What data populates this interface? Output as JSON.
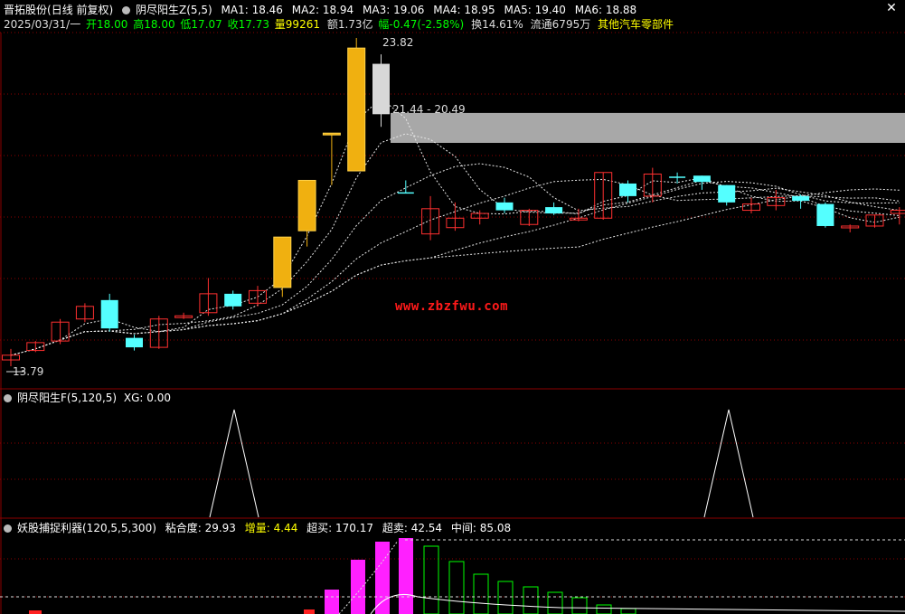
{
  "header": {
    "stock_name": "晋拓股份",
    "period": "(日线 前复权)",
    "indicator": "阴尽阳生Z(5,5)",
    "ma": [
      {
        "label": "MA1: 18.46",
        "color": "#ffffff"
      },
      {
        "label": "MA2: 18.94",
        "color": "#ffffff"
      },
      {
        "label": "MA3: 19.06",
        "color": "#ffffff"
      },
      {
        "label": "MA4: 18.95",
        "color": "#ffffff"
      },
      {
        "label": "MA5: 19.40",
        "color": "#ffffff"
      },
      {
        "label": "MA6: 18.88",
        "color": "#ffffff"
      }
    ],
    "close_symbol": "✕"
  },
  "quote": {
    "date": "2025/03/31/一",
    "open": "开18.00",
    "high": "高18.00",
    "low": "低17.07",
    "close": "收17.73",
    "volume": "量99261",
    "amount": "额1.73亿",
    "change": "幅-0.47(-2.58%)",
    "turnover": "换14.61%",
    "float": "流通6795万",
    "sector": "其他汽车零部件"
  },
  "main_chart": {
    "price_max_label": "23.82",
    "price_min_label": "13.79",
    "range_label": "21.44 - 20.49",
    "watermark": "www.zbzfwu.com",
    "candles": [
      {
        "o": 13.6,
        "c": 13.75,
        "h": 13.95,
        "l": 13.4,
        "up": true
      },
      {
        "o": 13.9,
        "c": 14.15,
        "h": 14.2,
        "l": 13.85,
        "up": true
      },
      {
        "o": 14.2,
        "c": 14.8,
        "h": 14.9,
        "l": 14.1,
        "up": true
      },
      {
        "o": 14.9,
        "c": 15.3,
        "h": 15.4,
        "l": 14.8,
        "up": true
      },
      {
        "o": 15.5,
        "c": 14.6,
        "h": 15.7,
        "l": 14.5,
        "up": false
      },
      {
        "o": 14.3,
        "c": 14.0,
        "h": 14.4,
        "l": 13.9,
        "up": false
      },
      {
        "o": 14.0,
        "c": 14.9,
        "h": 15.0,
        "l": 13.95,
        "up": true
      },
      {
        "o": 14.95,
        "c": 15.0,
        "h": 15.1,
        "l": 14.9,
        "up": true
      },
      {
        "o": 15.1,
        "c": 15.7,
        "h": 16.2,
        "l": 15.0,
        "up": true
      },
      {
        "o": 15.7,
        "c": 15.3,
        "h": 15.8,
        "l": 15.2,
        "up": false
      },
      {
        "o": 15.4,
        "c": 15.8,
        "h": 15.95,
        "l": 15.3,
        "up": true
      },
      {
        "o": 15.9,
        "c": 17.5,
        "h": 17.5,
        "l": 15.6,
        "up": true,
        "gold": true
      },
      {
        "o": 17.7,
        "c": 19.3,
        "h": 19.3,
        "l": 17.2,
        "up": true,
        "gold": true
      },
      {
        "o": 20.8,
        "c": 20.8,
        "h": 20.8,
        "l": 19.15,
        "up": true,
        "gold": true
      },
      {
        "o": 19.6,
        "c": 23.5,
        "h": 23.82,
        "l": 19.6,
        "up": true,
        "gold": true
      },
      {
        "o": 23.0,
        "c": 21.4,
        "h": 23.3,
        "l": 21.0,
        "up": false,
        "white": true
      },
      {
        "o": 18.9,
        "c": 18.9,
        "h": 19.3,
        "l": 18.9,
        "up": false,
        "cross": true
      },
      {
        "o": 17.6,
        "c": 18.4,
        "h": 18.8,
        "l": 17.4,
        "up": true
      },
      {
        "o": 17.8,
        "c": 18.1,
        "h": 18.6,
        "l": 17.7,
        "up": true
      },
      {
        "o": 18.1,
        "c": 18.25,
        "h": 18.35,
        "l": 17.9,
        "up": true
      },
      {
        "o": 18.6,
        "c": 18.35,
        "h": 18.75,
        "l": 18.25,
        "up": false
      },
      {
        "o": 17.9,
        "c": 18.35,
        "h": 18.4,
        "l": 17.85,
        "up": true
      },
      {
        "o": 18.45,
        "c": 18.25,
        "h": 18.6,
        "l": 18.2,
        "up": false
      },
      {
        "o": 18.05,
        "c": 18.1,
        "h": 18.4,
        "l": 18.0,
        "up": true
      },
      {
        "o": 18.1,
        "c": 19.55,
        "h": 19.55,
        "l": 18.05,
        "up": true
      },
      {
        "o": 19.2,
        "c": 18.8,
        "h": 19.3,
        "l": 18.6,
        "up": false
      },
      {
        "o": 18.8,
        "c": 19.5,
        "h": 19.7,
        "l": 18.6,
        "up": true
      },
      {
        "o": 19.4,
        "c": 19.4,
        "h": 19.55,
        "l": 19.2,
        "up": false,
        "cross": true
      },
      {
        "o": 19.45,
        "c": 19.25,
        "h": 19.45,
        "l": 19.0,
        "up": false
      },
      {
        "o": 19.15,
        "c": 18.6,
        "h": 19.15,
        "l": 18.5,
        "up": false
      },
      {
        "o": 18.35,
        "c": 18.55,
        "h": 18.75,
        "l": 18.25,
        "up": true
      },
      {
        "o": 18.5,
        "c": 18.75,
        "h": 19.0,
        "l": 18.35,
        "up": true
      },
      {
        "o": 18.8,
        "c": 18.65,
        "h": 18.85,
        "l": 18.4,
        "up": false
      },
      {
        "o": 18.55,
        "c": 17.85,
        "h": 18.6,
        "l": 17.8,
        "up": false
      },
      {
        "o": 17.8,
        "c": 17.85,
        "h": 17.9,
        "l": 17.65,
        "up": true
      },
      {
        "o": 17.85,
        "c": 18.2,
        "h": 18.2,
        "l": 17.8,
        "up": true
      },
      {
        "o": 18.25,
        "c": 18.35,
        "h": 18.45,
        "l": 17.9,
        "up": true
      }
    ]
  },
  "panel2": {
    "title": "阴尽阳生F(5,120,5)",
    "xg_label": "XG: 0.00"
  },
  "panel3": {
    "title": "妖股捕捉利器(120,5,5,300)",
    "stats": [
      {
        "label": "粘合度: 29.93",
        "color": "#ffffff"
      },
      {
        "label": "增量: 4.44",
        "color": "#ffff00"
      },
      {
        "label": "超买: 170.17",
        "color": "#ffffff"
      },
      {
        "label": "超卖: 42.54",
        "color": "#ffffff"
      },
      {
        "label": "中间: 85.08",
        "color": "#ffffff"
      }
    ]
  },
  "colors": {
    "up": "#ff3030",
    "down": "#54ffff",
    "gold": "#f0b010",
    "grid": "#8b0000",
    "green": "#00ff00",
    "magenta": "#ff20ff",
    "yellow": "#ffff00"
  }
}
